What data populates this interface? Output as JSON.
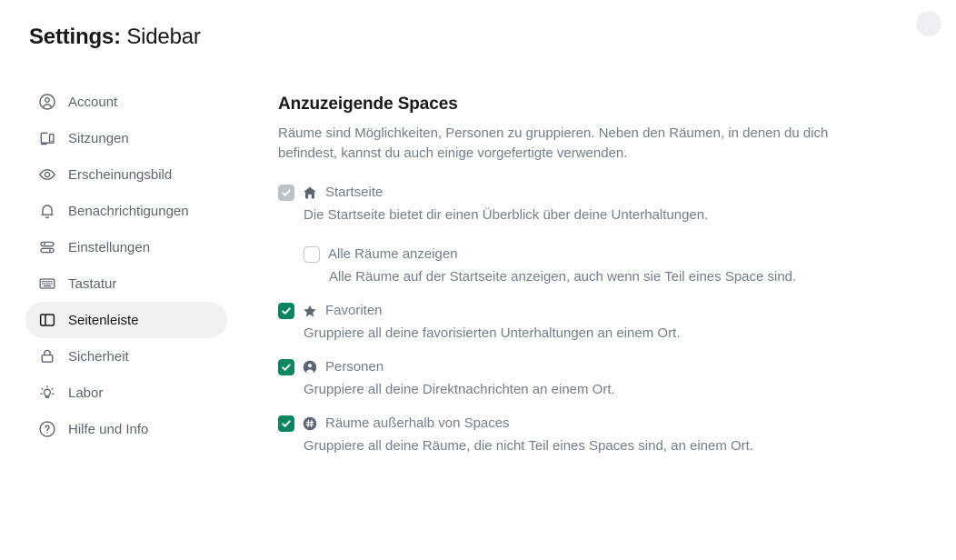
{
  "window": {
    "title_strong": "Settings:",
    "title_light": "Sidebar",
    "close_label": ""
  },
  "sidebar": {
    "items": [
      {
        "label": "Account",
        "icon": "user-circle-icon",
        "active": false
      },
      {
        "label": "Sitzungen",
        "icon": "devices-icon",
        "active": false
      },
      {
        "label": "Erscheinungsbild",
        "icon": "eye-icon",
        "active": false
      },
      {
        "label": "Benachrichtigungen",
        "icon": "bell-icon",
        "active": false
      },
      {
        "label": "Einstellungen",
        "icon": "sliders-icon",
        "active": false
      },
      {
        "label": "Tastatur",
        "icon": "keyboard-icon",
        "active": false
      },
      {
        "label": "Seitenleiste",
        "icon": "sidebar-icon",
        "active": true
      },
      {
        "label": "Sicherheit",
        "icon": "lock-icon",
        "active": false
      },
      {
        "label": "Labor",
        "icon": "lightbulb-icon",
        "active": false
      },
      {
        "label": "Hilfe und Info",
        "icon": "question-circle-icon",
        "active": false
      }
    ]
  },
  "main": {
    "section_title": "Anzuzeigende Spaces",
    "section_desc": "Räume sind Möglichkeiten, Personen zu gruppieren. Neben den Räumen, in denen du dich befindest, kannst du auch einige vorgefertigte verwenden.",
    "options": [
      {
        "title": "Startseite",
        "desc": "Die Startseite bietet dir einen Überblick über deine Unterhaltungen.",
        "icon": "home-icon",
        "checked": true,
        "disabled": true,
        "nested": false
      },
      {
        "title": "Alle Räume anzeigen",
        "desc": "Alle Räume auf der Startseite anzeigen, auch wenn sie Teil eines Space sind.",
        "icon": "",
        "checked": false,
        "disabled": false,
        "nested": true
      },
      {
        "title": "Favoriten",
        "desc": "Gruppiere all deine favorisierten Unterhaltungen an einem Ort.",
        "icon": "star-icon",
        "checked": true,
        "disabled": false,
        "nested": false
      },
      {
        "title": "Personen",
        "desc": "Gruppiere all deine Direktnachrichten an einem Ort.",
        "icon": "person-filled-icon",
        "checked": true,
        "disabled": false,
        "nested": false
      },
      {
        "title": "Räume außerhalb von Spaces",
        "desc": "Gruppiere all deine Räume, die nicht Teil eines Spaces sind, an einem Ort.",
        "icon": "hash-filled-icon",
        "checked": true,
        "disabled": false,
        "nested": false
      }
    ]
  },
  "colors": {
    "accent_green": "#0A8560",
    "active_nav_bg": "#F0F1F3",
    "text_primary": "#17191C",
    "text_secondary": "#737D8C",
    "nav_text": "#5D6472",
    "checkbox_disabled": "#BCC1C8",
    "close_bg": "#EDEFF2"
  }
}
